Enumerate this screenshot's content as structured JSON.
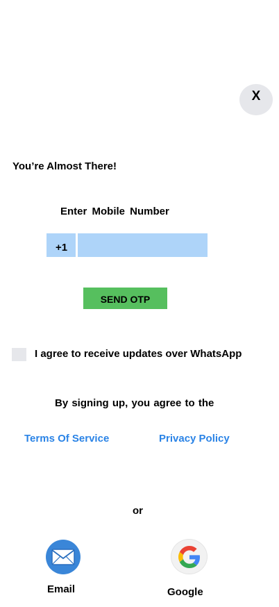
{
  "close": {
    "label": "X"
  },
  "title": "You’re Almost There!",
  "mobile": {
    "label": "Enter  Mobile  Number",
    "country_code": "+1",
    "value": "",
    "placeholder": ""
  },
  "send_otp": {
    "label": "SEND OTP"
  },
  "whatsapp": {
    "label": "I agree to receive updates over WhatsApp",
    "checked": false
  },
  "terms": {
    "intro": "By signing up, you agree to  the",
    "tos_label": "Terms Of Service",
    "privacy_label": "Privacy Policy"
  },
  "or_label": "or",
  "social": {
    "email_label": "Email",
    "google_label": "Google"
  },
  "colors": {
    "input_bg": "#aed4f9",
    "otp_green": "#56bf5e",
    "link_blue": "#2a83e6",
    "email_blue": "#3a86d8"
  }
}
